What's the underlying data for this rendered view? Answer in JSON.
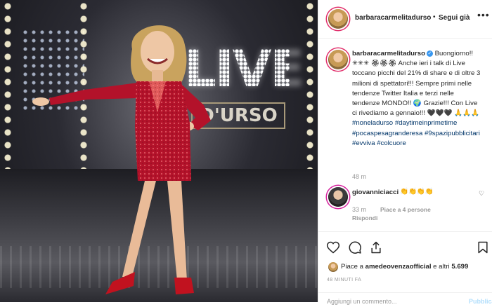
{
  "post": {
    "username": "barbaracarmelitadurso",
    "follow_label": "Segui già",
    "separator": "•",
    "more_icon": "more-icon"
  },
  "photo": {
    "sign_main": "LIVE",
    "sign_sub": "D'URSO"
  },
  "caption": {
    "username": "barbaracarmelitadurso",
    "verified": "✓",
    "text": "Buongiorno!! ✳✳✳ 🏵🏵🏵 Anche ieri i talk di Live toccano picchi del 21% di share e di oltre 3 milioni di spettatori!!! Sempre primi nelle tendenze Twitter Italia e terzi nelle tendenze MONDO!! 🌍 Grazie!!! Con Live ci rivediamo a gennaio!!! 🖤🖤🖤 🙏🙏🙏",
    "hashtags": [
      "#noneladurso",
      "#daytimeinprimetime",
      "#pocaspesagranderesa",
      "#9spazipubblicitari",
      "#evviva",
      "#colcuore"
    ],
    "time": "48 m"
  },
  "comment": {
    "username": "giovanniciacci",
    "text": "👏👏👏👏",
    "time": "33 m",
    "likes": "Piace a 4 persone",
    "reply": "Rispondi"
  },
  "likes": {
    "prefix": "Piace a ",
    "user": "amedeovenzaofficial",
    "middle": " e altri ",
    "count": "5.699"
  },
  "post_time": "48 MINUTI FA",
  "add_comment": {
    "placeholder": "Aggiungi un commento...",
    "publish": "Pubblica"
  },
  "colors": {
    "accent": "#3897f0",
    "hashtag": "#003569",
    "story_ring": "#e1306c",
    "dress": "#b3122a"
  }
}
